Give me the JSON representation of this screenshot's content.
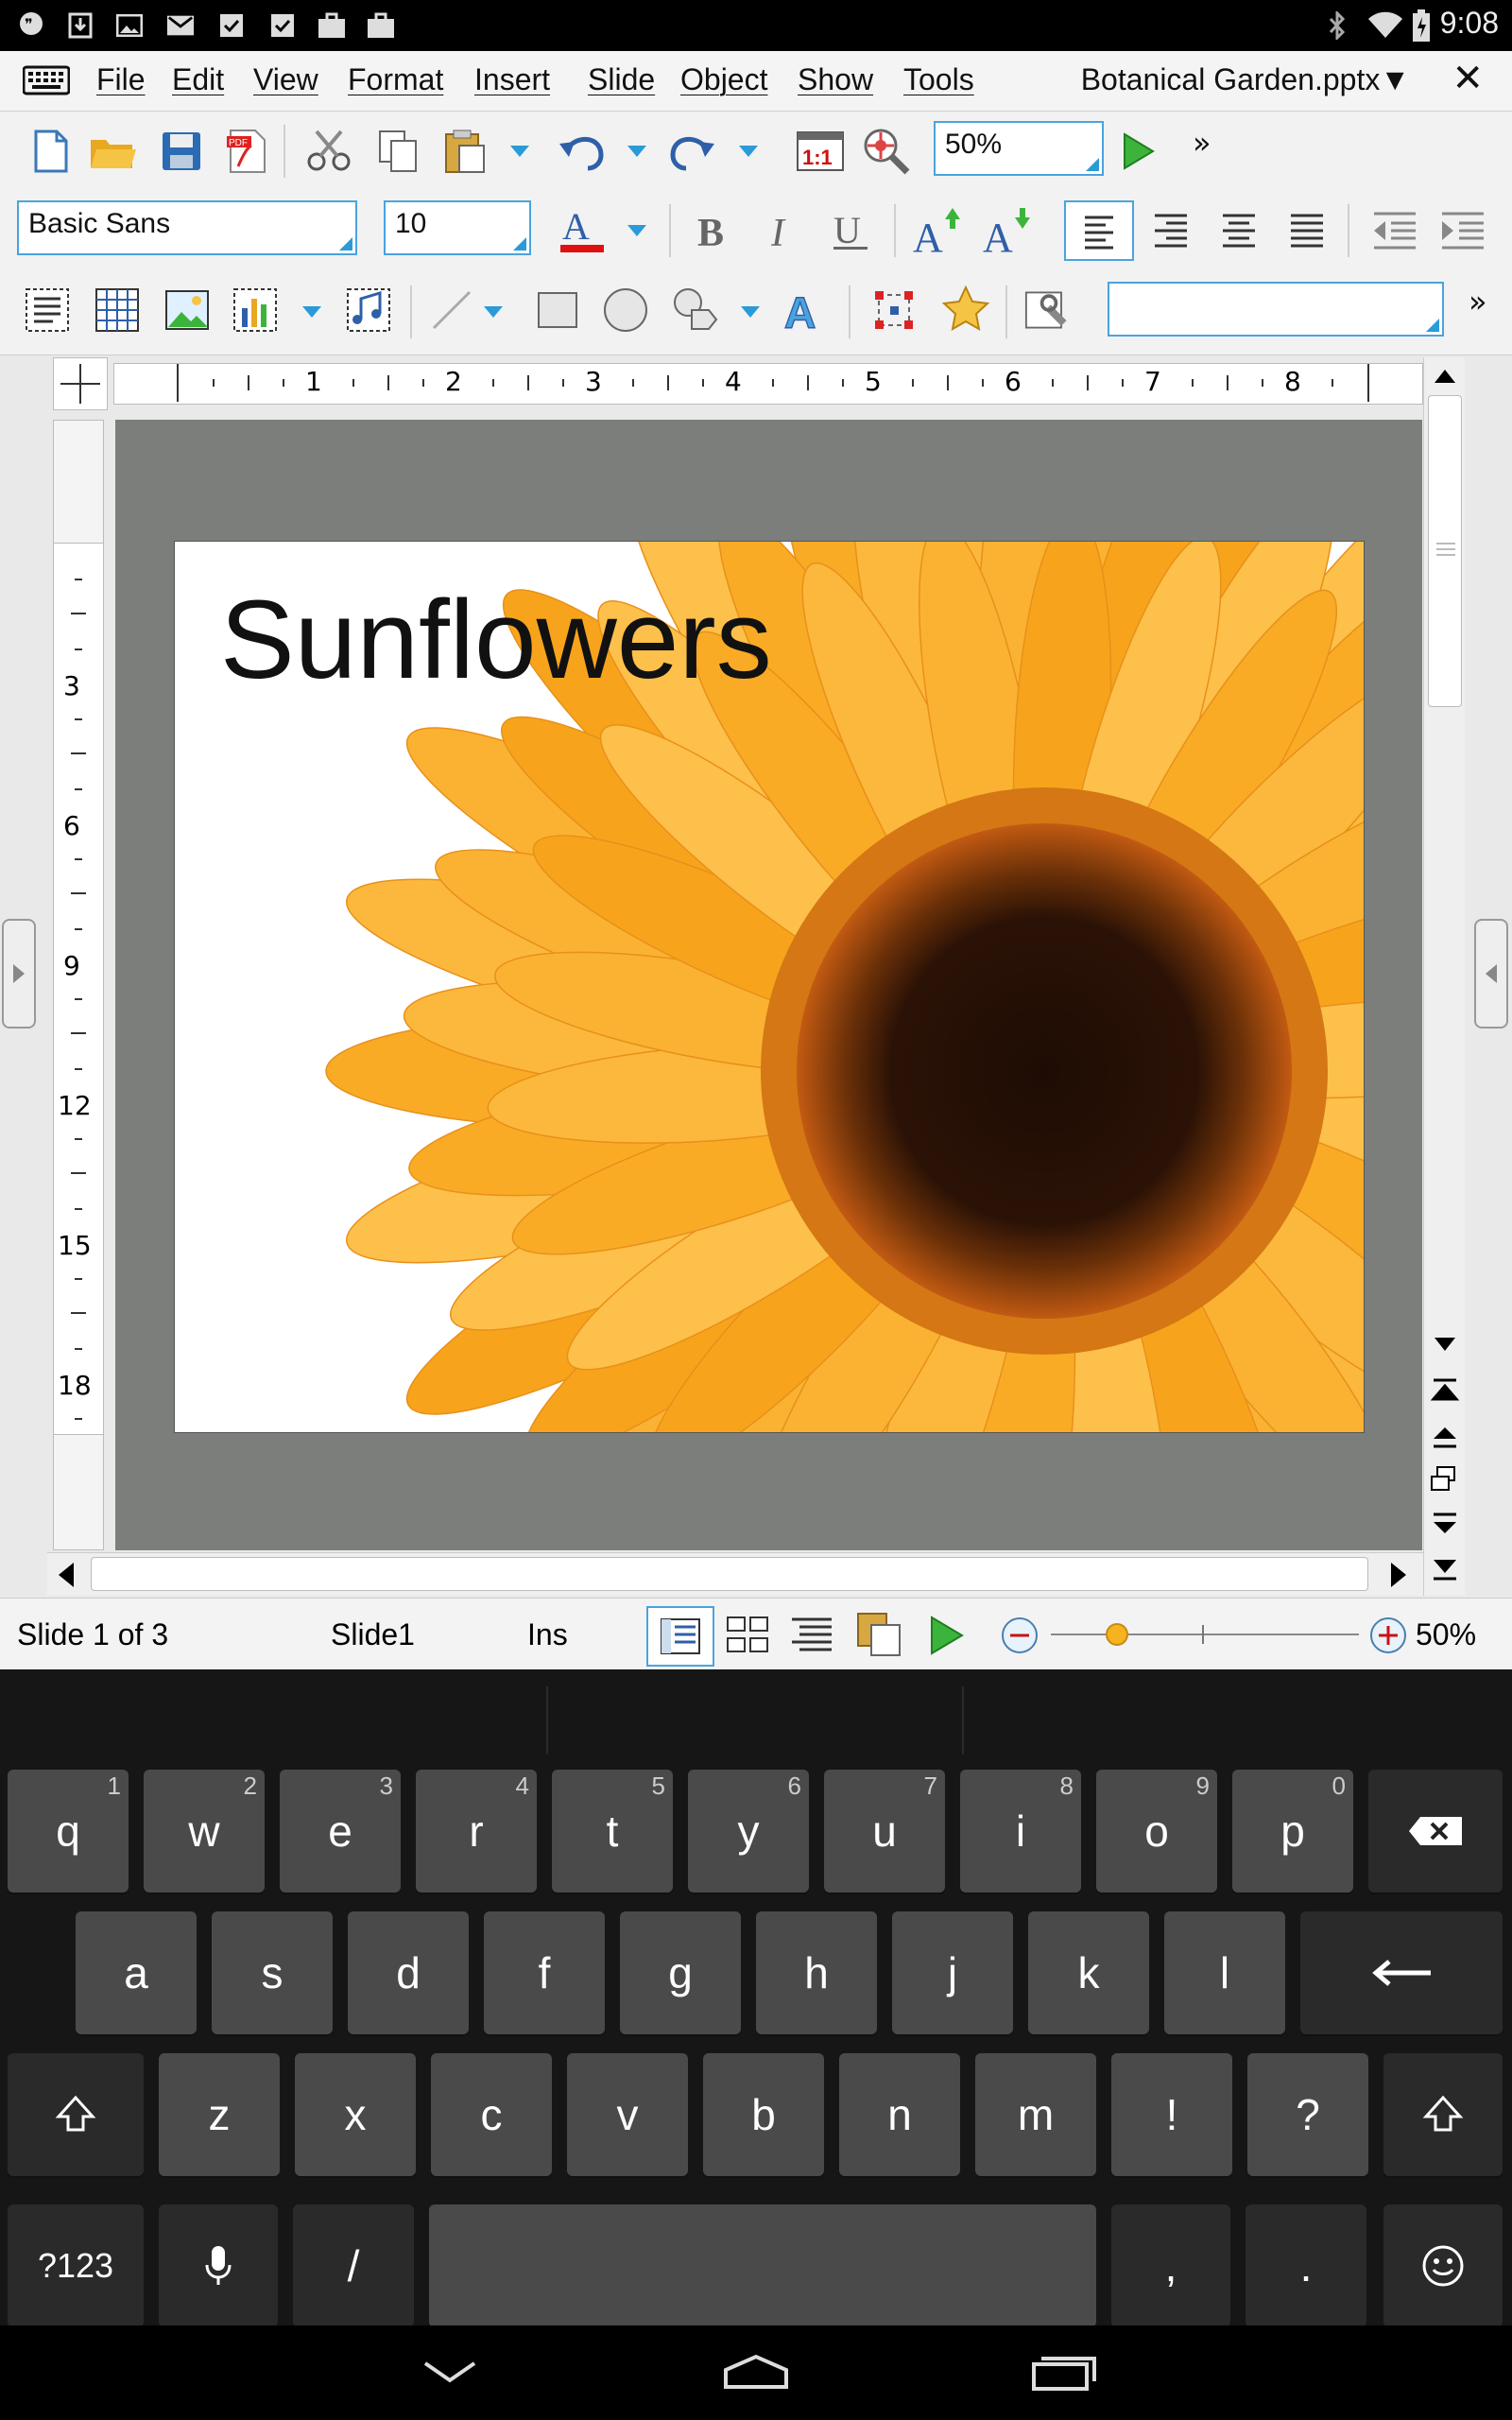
{
  "status_bar": {
    "time": "9:08"
  },
  "menu": {
    "items": [
      "File",
      "Edit",
      "View",
      "Format",
      "Insert",
      "Slide",
      "Object",
      "Show",
      "Tools"
    ],
    "document_title": "Botanical Garden.pptx▼",
    "close_label": "✕"
  },
  "toolbar1": {
    "zoom_value": "50%",
    "more_label": "»"
  },
  "toolbar2": {
    "font_name": "Basic Sans",
    "font_size": "10"
  },
  "toolbar3": {
    "style_value": "",
    "more_label": "»"
  },
  "slide": {
    "title": "Sunflowers"
  },
  "rulers": {
    "horizontal": [
      "1",
      "2",
      "3",
      "4",
      "5",
      "6",
      "7",
      "8"
    ],
    "vertical": [
      "3",
      "6",
      "9",
      "12",
      "15",
      "18"
    ]
  },
  "app_status": {
    "slide_position": "Slide 1 of 3",
    "slide_name": "Slide1",
    "insert_mode": "Ins",
    "zoom": "50%"
  },
  "keyboard": {
    "row1": [
      {
        "k": "q",
        "s": "1"
      },
      {
        "k": "w",
        "s": "2"
      },
      {
        "k": "e",
        "s": "3"
      },
      {
        "k": "r",
        "s": "4"
      },
      {
        "k": "t",
        "s": "5"
      },
      {
        "k": "y",
        "s": "6"
      },
      {
        "k": "u",
        "s": "7"
      },
      {
        "k": "i",
        "s": "8"
      },
      {
        "k": "o",
        "s": "9"
      },
      {
        "k": "p",
        "s": "0"
      }
    ],
    "row2": [
      "a",
      "s",
      "d",
      "f",
      "g",
      "h",
      "j",
      "k",
      "l"
    ],
    "row3": [
      "z",
      "x",
      "c",
      "v",
      "b",
      "n",
      "m",
      "!",
      "?"
    ],
    "symbols_label": "?123",
    "slash_label": "/",
    "comma_label": ",",
    "period_label": "."
  },
  "colors": {
    "accent": "#2a9bd8",
    "canvas": "#7c7e7c",
    "font_color_bar": "#e01010",
    "play": "#3cb43c"
  }
}
